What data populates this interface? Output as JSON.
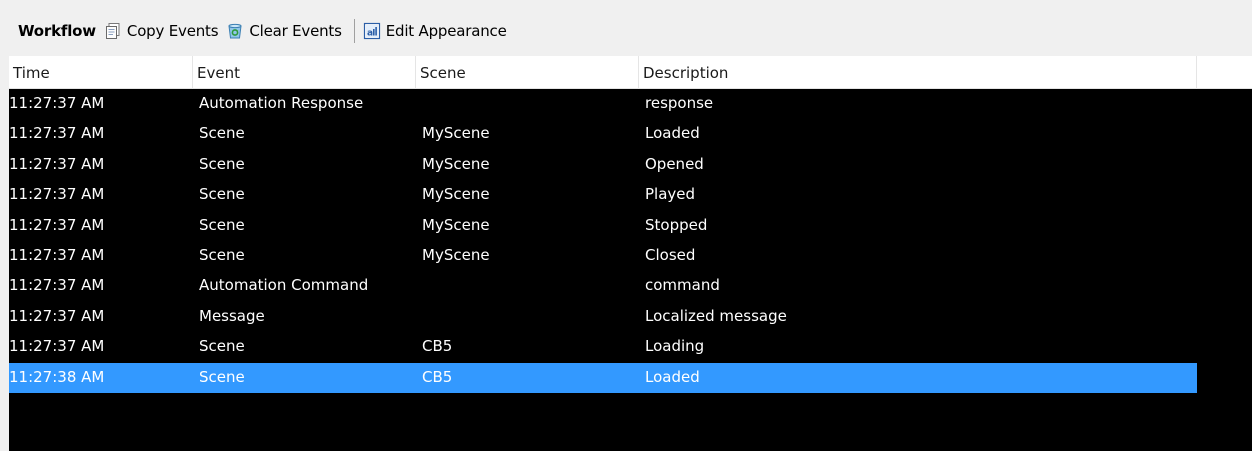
{
  "toolbar": {
    "title": "Workflow",
    "copy_label": "Copy Events",
    "clear_label": "Clear Events",
    "edit_label": "Edit Appearance",
    "icons": {
      "copy": "copy-icon",
      "clear": "recycle-bin-icon",
      "edit": "appearance-icon"
    }
  },
  "grid": {
    "columns": [
      "Time",
      "Event",
      "Scene",
      "Description"
    ],
    "rows": [
      {
        "time": "11:27:37 AM",
        "event": "Automation Response",
        "scene": "",
        "description": "response"
      },
      {
        "time": "11:27:37 AM",
        "event": "Scene",
        "scene": "MyScene",
        "description": "Loaded"
      },
      {
        "time": "11:27:37 AM",
        "event": "Scene",
        "scene": "MyScene",
        "description": "Opened"
      },
      {
        "time": "11:27:37 AM",
        "event": "Scene",
        "scene": "MyScene",
        "description": "Played"
      },
      {
        "time": "11:27:37 AM",
        "event": "Scene",
        "scene": "MyScene",
        "description": "Stopped"
      },
      {
        "time": "11:27:37 AM",
        "event": "Scene",
        "scene": "MyScene",
        "description": "Closed"
      },
      {
        "time": "11:27:37 AM",
        "event": "Automation Command",
        "scene": "",
        "description": "command"
      },
      {
        "time": "11:27:37 AM",
        "event": "Message",
        "scene": "",
        "description": "Localized message"
      },
      {
        "time": "11:27:37 AM",
        "event": "Scene",
        "scene": "CB5",
        "description": "Loading"
      },
      {
        "time": "11:27:38 AM",
        "event": "Scene",
        "scene": "CB5",
        "description": "Loaded",
        "selected": true
      }
    ]
  },
  "colors": {
    "grid_background": "#000000",
    "row_text": "#ffffff",
    "selection": "#3399ff",
    "header_background": "#ffffff",
    "toolbar_background": "#f0f0f0"
  }
}
